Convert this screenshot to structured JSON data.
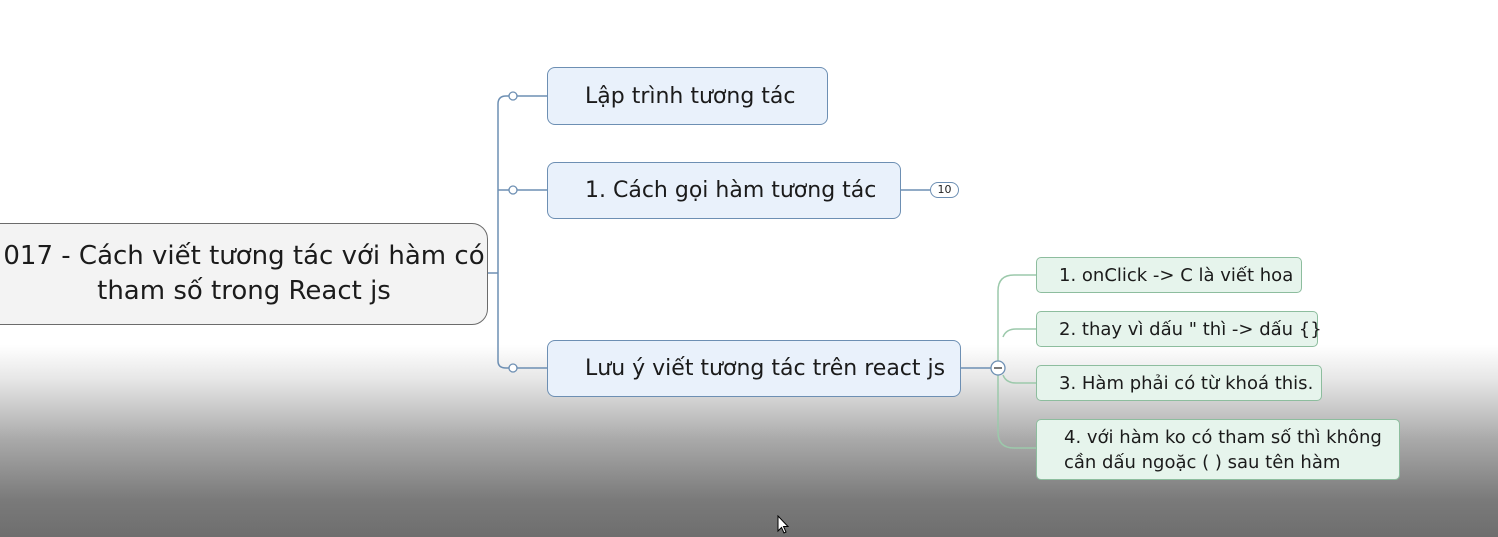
{
  "central_topic": "017 - Cách viết tương tác với hàm có tham số trong React js",
  "branches": [
    {
      "label": "Lập trình tương tác"
    },
    {
      "label": "1. Cách gọi hàm tương tác",
      "collapsed_count": "10"
    },
    {
      "label": "Lưu ý viết tương tác trên react js",
      "children": [
        {
          "label": "1. onClick -> C là viết hoa"
        },
        {
          "label": "2. thay vì dấu \" thì -> dấu {}"
        },
        {
          "label": "3. Hàm phải có từ khoá this."
        },
        {
          "label": "4. với hàm ko có tham số thì không cần dấu ngoặc ( ) sau tên hàm"
        }
      ]
    }
  ],
  "colors": {
    "main_topic_fill": "#e9f1fb",
    "main_topic_border": "#6d8fb3",
    "subtopic_fill": "#e6f4ec",
    "subtopic_border": "#8dbd9e",
    "connector": "#6d8fb3",
    "sub_connector": "#9cc9ab"
  },
  "icons": [
    "collapse-toggle-icon",
    "mouse-cursor-icon"
  ]
}
